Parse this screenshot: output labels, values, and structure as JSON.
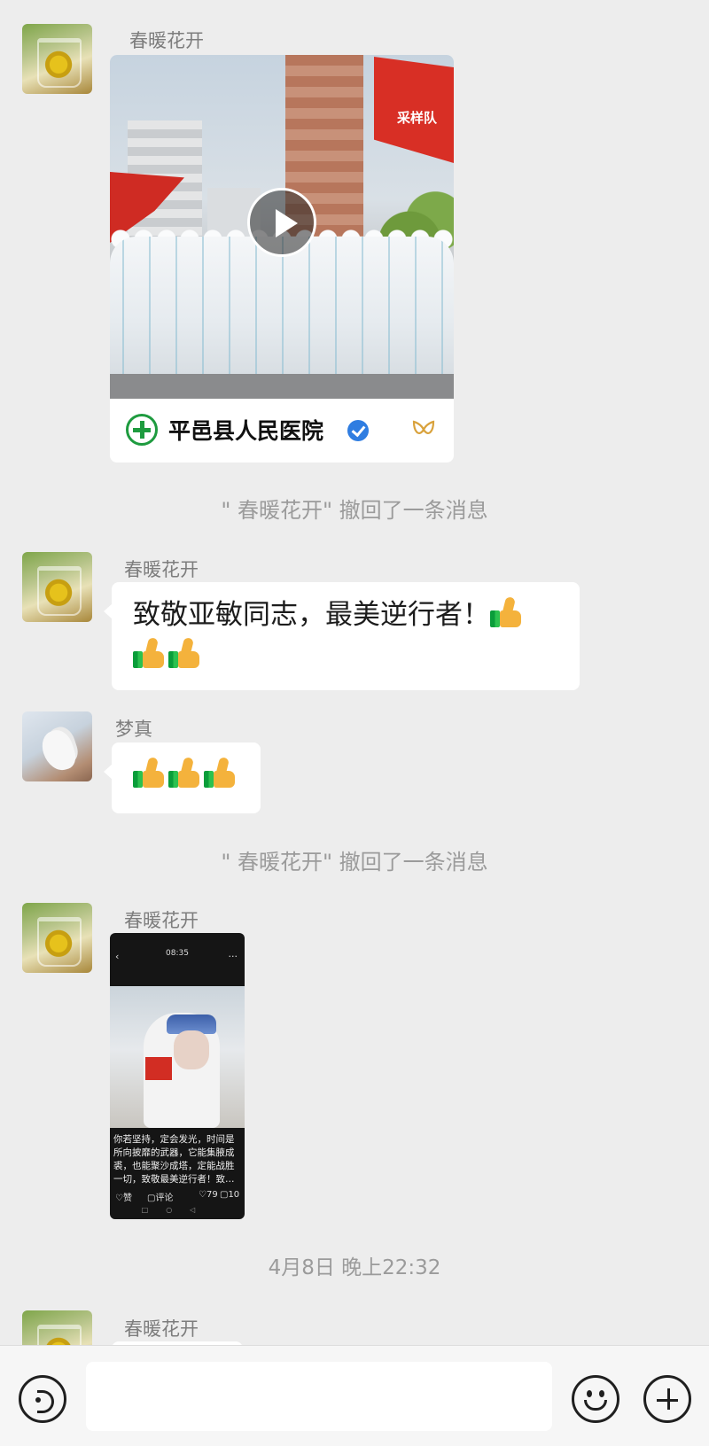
{
  "messages": {
    "m1": {
      "sender": "春暖花开",
      "channel_name": "平邑县人民医院",
      "video_flag_text": "采样队"
    },
    "notice1": "\" 春暖花开\" 撤回了一条消息",
    "m2": {
      "sender": "春暖花开",
      "text_line1": "致敬亚敏同志，最美逆行者！",
      "thumbs_count": 3
    },
    "m3": {
      "sender": "梦真",
      "thumbs_count": 3
    },
    "notice2": "\" 春暖花开\" 撤回了一条消息",
    "m4": {
      "sender": "春暖花开",
      "screenshot": {
        "time": "08:35",
        "caption": "你若坚持，定会发光，时间是所向披靡的武器，它能集腋成裘，也能聚沙成塔，定能战胜一切，致敬最美逆行者！致…",
        "like_label": "♡赞",
        "comment_label": "▢评论",
        "likes": "♡79",
        "comments": "▢10"
      }
    },
    "timestamp": "4月8日 晚上22:32",
    "m5": {
      "sender": "春暖花开"
    }
  },
  "input_bar": {
    "value": ""
  },
  "icons": {
    "voice": "voice-icon",
    "emoji": "emoji-icon",
    "plus": "plus-icon",
    "play": "play-icon",
    "verified": "verified-icon",
    "channels": "channels-icon",
    "thumbs_up": "thumbs-up-icon"
  },
  "colors": {
    "background": "#ededed",
    "bubble": "#ffffff",
    "channel_logo": "#1e9b3f",
    "verified": "#2f7de1",
    "channels_icon": "#d9a23c"
  }
}
